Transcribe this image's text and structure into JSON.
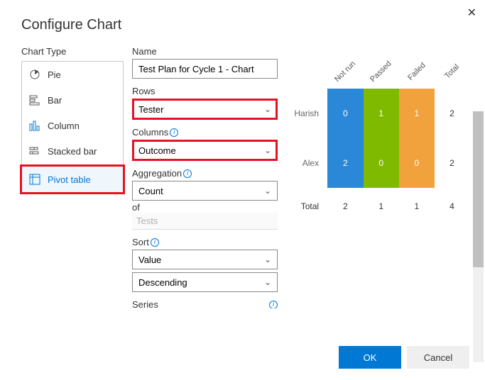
{
  "dialog": {
    "title": "Configure Chart",
    "chart_type_label": "Chart Type",
    "types": [
      {
        "label": "Pie"
      },
      {
        "label": "Bar"
      },
      {
        "label": "Column"
      },
      {
        "label": "Stacked bar"
      },
      {
        "label": "Pivot table"
      }
    ]
  },
  "form": {
    "name_label": "Name",
    "name_value": "Test Plan for Cycle 1 - Chart",
    "rows_label": "Rows",
    "rows_value": "Tester",
    "columns_label": "Columns",
    "columns_value": "Outcome",
    "aggregation_label": "Aggregation",
    "aggregation_value": "Count",
    "of_label": "of",
    "of_value": "Tests",
    "sort_label": "Sort",
    "sort_by": "Value",
    "sort_dir": "Descending",
    "series_label": "Series"
  },
  "buttons": {
    "ok": "OK",
    "cancel": "Cancel"
  },
  "chart_data": {
    "type": "table",
    "title": "",
    "columns": [
      "Not run",
      "Passed",
      "Failed",
      "Total"
    ],
    "rows": [
      "Harish",
      "Alex",
      "Total"
    ],
    "values": [
      [
        0,
        1,
        1,
        2
      ],
      [
        2,
        0,
        0,
        2
      ],
      [
        2,
        1,
        1,
        4
      ]
    ],
    "col_colors": [
      "#2b88d8",
      "#7fba00",
      "#f2a23c",
      ""
    ]
  }
}
